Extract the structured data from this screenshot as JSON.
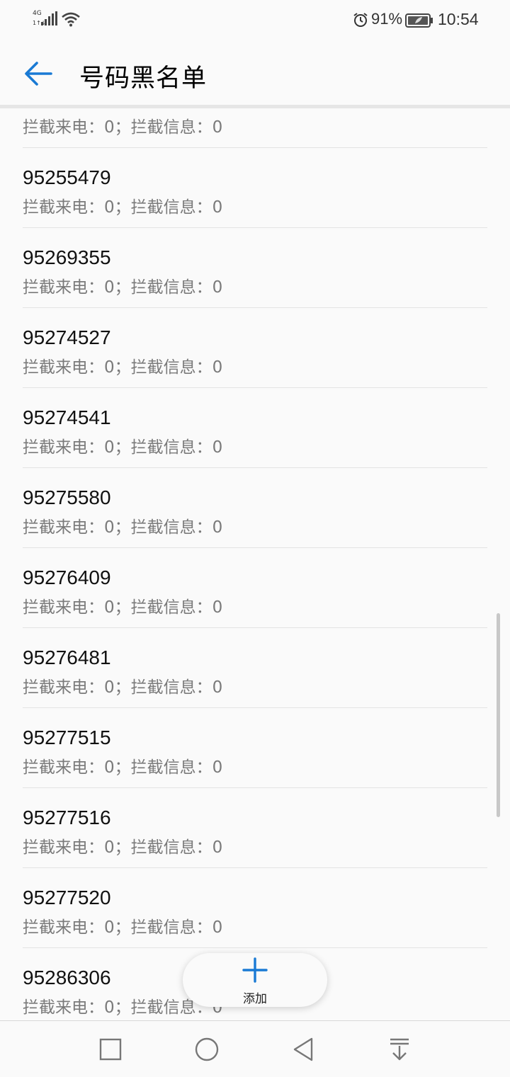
{
  "status_bar": {
    "network_type": "4G",
    "network_sub": "1↑↓",
    "battery_percent": "91%",
    "time": "10:54",
    "icons": [
      "signal-icon",
      "wifi-icon",
      "alarm-icon",
      "battery-icon"
    ]
  },
  "app_bar": {
    "back_icon": "back-arrow-icon",
    "title": "号码黑名单",
    "accent_color": "#1a7ad4"
  },
  "list": {
    "partial_top_subtitle": "拦截来电：0；拦截信息：0",
    "items": [
      {
        "number": "95255479",
        "subtitle": "拦截来电：0；拦截信息：0"
      },
      {
        "number": "95269355",
        "subtitle": "拦截来电：0；拦截信息：0"
      },
      {
        "number": "95274527",
        "subtitle": "拦截来电：0；拦截信息：0"
      },
      {
        "number": "95274541",
        "subtitle": "拦截来电：0；拦截信息：0"
      },
      {
        "number": "95275580",
        "subtitle": "拦截来电：0；拦截信息：0"
      },
      {
        "number": "95276409",
        "subtitle": "拦截来电：0；拦截信息：0"
      },
      {
        "number": "95276481",
        "subtitle": "拦截来电：0；拦截信息：0"
      },
      {
        "number": "95277515",
        "subtitle": "拦截来电：0；拦截信息：0"
      },
      {
        "number": "95277516",
        "subtitle": "拦截来电：0；拦截信息：0"
      },
      {
        "number": "95277520",
        "subtitle": "拦截来电：0；拦截信息：0"
      },
      {
        "number": "95286306",
        "subtitle": "拦截来电：0；拦截信息：0"
      }
    ]
  },
  "fab": {
    "icon": "plus-icon",
    "label": "添加"
  },
  "nav_bar": {
    "icons": [
      "recents-square-icon",
      "home-circle-icon",
      "back-triangle-icon",
      "notification-pull-icon"
    ]
  }
}
